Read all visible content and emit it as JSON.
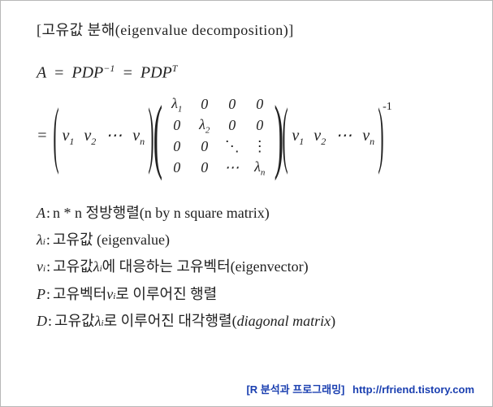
{
  "title": "[고유값 분해(eigenvalue decomposition)]",
  "eq1": {
    "lhs": "A",
    "eq": "=",
    "rhs1": "PDP",
    "exp1": "−1",
    "rhs2": "PDP",
    "exp2": "T"
  },
  "eq2": {
    "prefix": "=",
    "vec": {
      "v1": "v",
      "s1": "1",
      "v2": "v",
      "s2": "2",
      "dots": "⋯",
      "vn": "v",
      "sn": "n"
    },
    "matrix": {
      "r1": [
        "λ",
        "0",
        "0",
        "0"
      ],
      "r1s": "1",
      "r2": [
        "0",
        "λ",
        "0",
        "0"
      ],
      "r2s": "2",
      "r3": [
        "0",
        "0",
        "⋱",
        "⋮"
      ],
      "r4": [
        "0",
        "0",
        "⋯",
        "λ"
      ],
      "r4s": "n"
    },
    "vec2": {
      "v1": "v",
      "s1": "1",
      "v2": "v",
      "s2": "2",
      "dots": "⋯",
      "vn": "v",
      "sn": "n"
    },
    "sup": "-1"
  },
  "defs": {
    "A": {
      "sym": "A",
      "text": "n * n 정방행렬(n by n square matrix)"
    },
    "lambda": {
      "sym": "λ",
      "sub": "i",
      "text": "고유값 (eigenvalue)"
    },
    "v": {
      "sym": "v",
      "sub": "i",
      "pre": "고유값 ",
      "mid_sym": "λ",
      "mid_sub": "i",
      "post": "에 대응하는 고유벡터(eigenvector)"
    },
    "P": {
      "sym": "P",
      "pre": "고유벡터",
      "mid_sym": "v",
      "mid_sub": "i",
      "post": " 로 이루어진 행렬"
    },
    "D": {
      "sym": "D",
      "pre": "고유값 ",
      "mid_sym": "λ",
      "mid_sub": "i",
      "post_plain": " 로 이루어진 대각행렬(",
      "post_em": "diagonal matrix",
      "post_close": ")"
    }
  },
  "footer": {
    "tag": "[R 분석과 프로그래밍]",
    "url": "http://rfriend.tistory.com"
  }
}
